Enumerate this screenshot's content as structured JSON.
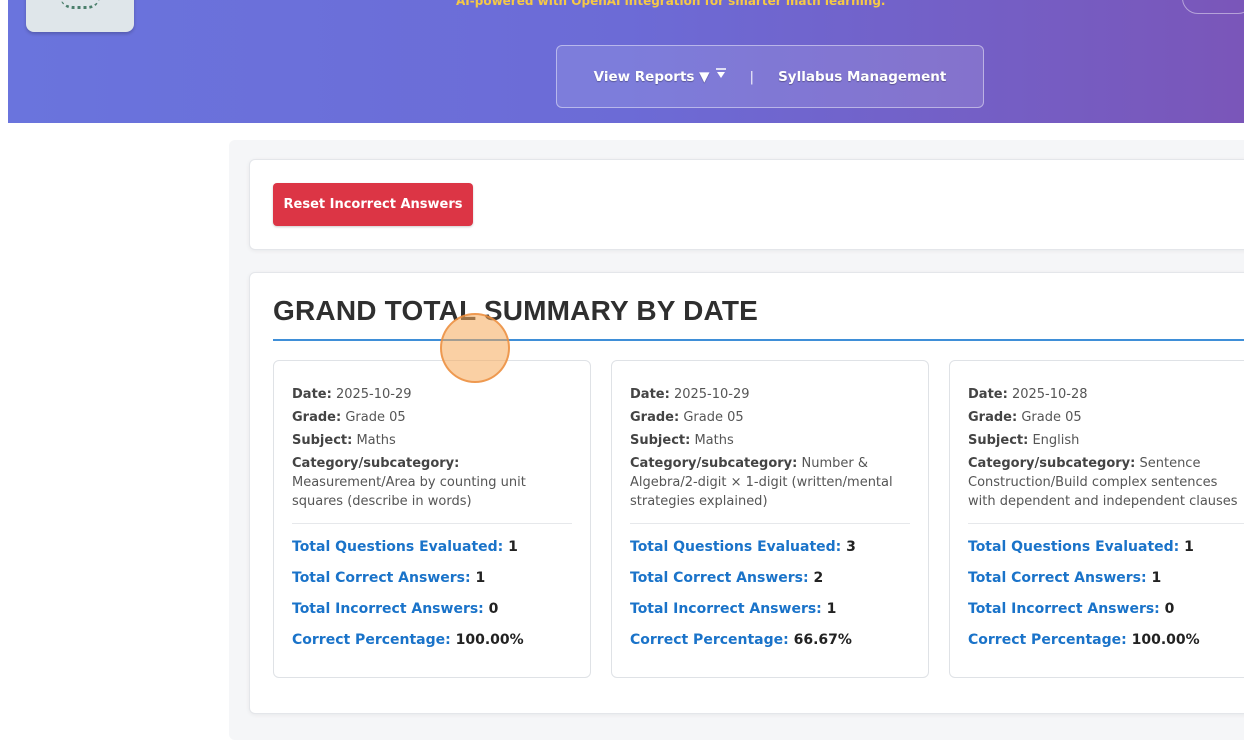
{
  "header": {
    "tagline": "AI-powered with OpenAI integration for smarter math learning.",
    "nav": {
      "view_reports_label": "View Reports ▼",
      "separator": "|",
      "syllabus_label": "Syllabus Management"
    }
  },
  "actions": {
    "reset_label": "Reset Incorrect Answers"
  },
  "summary": {
    "title": "GRAND TOTAL SUMMARY BY DATE",
    "labels": {
      "date": "Date:",
      "grade": "Grade:",
      "subject": "Subject:",
      "category": "Category/subcategory:",
      "total_questions": "Total Questions Evaluated:",
      "total_correct": "Total Correct Answers:",
      "total_incorrect": "Total Incorrect Answers:",
      "correct_percentage": "Correct Percentage:"
    },
    "cards": [
      {
        "date": "2025-10-29",
        "grade": "Grade 05",
        "subject": "Maths",
        "category": "Measurement/Area by counting unit squares (describe in words)",
        "total_questions": "1",
        "total_correct": "1",
        "total_incorrect": "0",
        "correct_percentage": "100.00%"
      },
      {
        "date": "2025-10-29",
        "grade": "Grade 05",
        "subject": "Maths",
        "category": "Number & Algebra/2-digit × 1-digit (written/mental strategies explained)",
        "total_questions": "3",
        "total_correct": "2",
        "total_incorrect": "1",
        "correct_percentage": "66.67%"
      },
      {
        "date": "2025-10-28",
        "grade": "Grade 05",
        "subject": "English",
        "category": "Sentence Construction/Build complex sentences with dependent and independent clauses",
        "total_questions": "1",
        "total_correct": "1",
        "total_incorrect": "0",
        "correct_percentage": "100.00%"
      }
    ]
  },
  "colors": {
    "header_start": "#6a74dd",
    "header_end": "#7a56b9",
    "tagline": "#f6c945",
    "reset_button": "#dc3545",
    "stat_label": "#1a73c9",
    "rule": "#3f8fd8"
  }
}
